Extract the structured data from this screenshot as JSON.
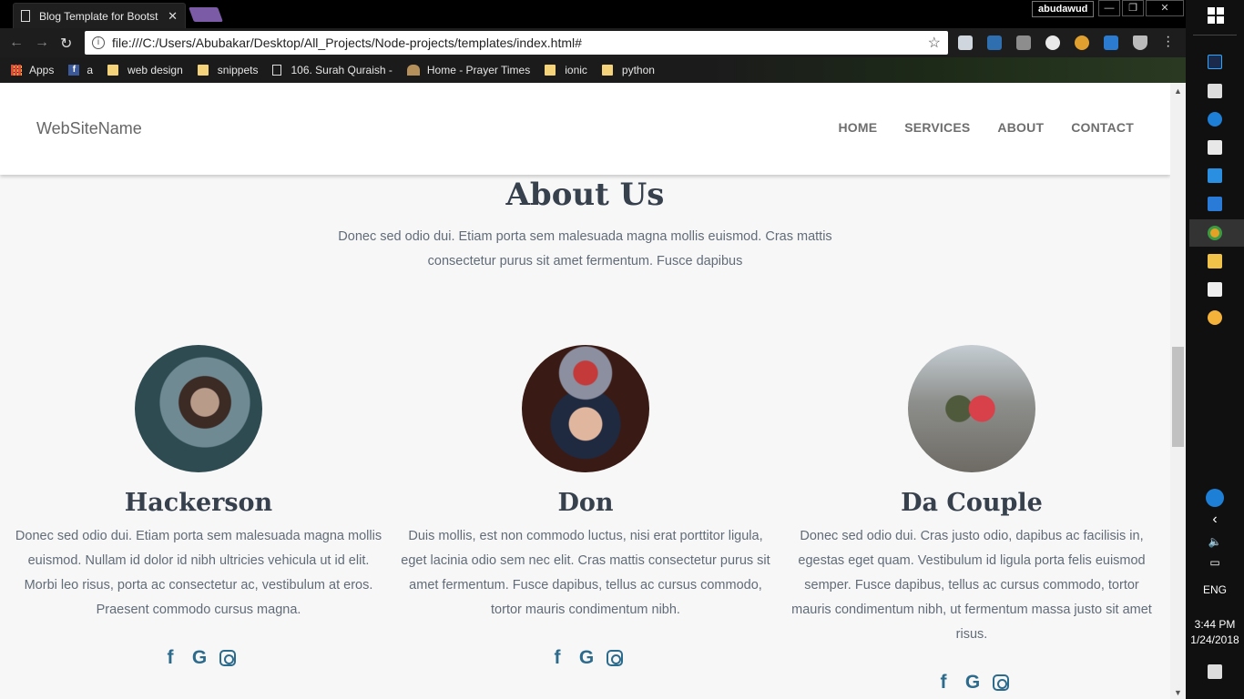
{
  "browser": {
    "tab_title": "Blog Template for Bootst",
    "profile_name": "abudawud",
    "url": "file:///C:/Users/Abubakar/Desktop/All_Projects/Node-projects/templates/index.html#",
    "bookmarks": [
      {
        "label": "Apps",
        "icon": "apps-grid-icon"
      },
      {
        "label": "a",
        "icon": "facebook-icon"
      },
      {
        "label": "web design",
        "icon": "folder-icon"
      },
      {
        "label": "snippets",
        "icon": "folder-icon"
      },
      {
        "label": "106. Surah Quraish -",
        "icon": "page-icon"
      },
      {
        "label": "Home - Prayer Times",
        "icon": "mosque-icon"
      },
      {
        "label": "ionic",
        "icon": "folder-icon"
      },
      {
        "label": "python",
        "icon": "folder-icon"
      }
    ]
  },
  "site": {
    "brand": "WebSiteName",
    "nav": [
      "HOME",
      "SERVICES",
      "ABOUT",
      "CONTACT"
    ],
    "about": {
      "title": "About Us",
      "subtitle": "Donec sed odio dui. Etiam porta sem malesuada magna mollis euismod. Cras mattis consectetur purus sit amet fermentum. Fusce dapibus"
    },
    "members": [
      {
        "name": "Hackerson",
        "bio": "Donec sed odio dui. Etiam porta sem malesuada magna mollis euismod. Nullam id dolor id nibh ultricies vehicula ut id elit. Morbi leo risus, porta ac consectetur ac, vestibulum at eros. Praesent commodo cursus magna."
      },
      {
        "name": "Don",
        "bio": "Duis mollis, est non commodo luctus, nisi erat porttitor ligula, eget lacinia odio sem nec elit. Cras mattis consectetur purus sit amet fermentum. Fusce dapibus, tellus ac cursus commodo, tortor mauris condimentum nibh."
      },
      {
        "name": "Da Couple",
        "bio": "Donec sed odio dui. Cras justo odio, dapibus ac facilisis in, egestas eget quam. Vestibulum id ligula porta felis euismod semper. Fusce dapibus, tellus ac cursus commodo, tortor mauris condimentum nibh, ut fermentum massa justo sit amet risus."
      }
    ],
    "social_icons": [
      "facebook-icon",
      "google-icon",
      "instagram-icon"
    ],
    "social_glyphs": {
      "facebook": "f",
      "google": "G"
    },
    "accent_color": "#2d6b8c"
  },
  "taskbar": {
    "language": "ENG",
    "time": "3:44 PM",
    "date": "1/24/2018"
  }
}
